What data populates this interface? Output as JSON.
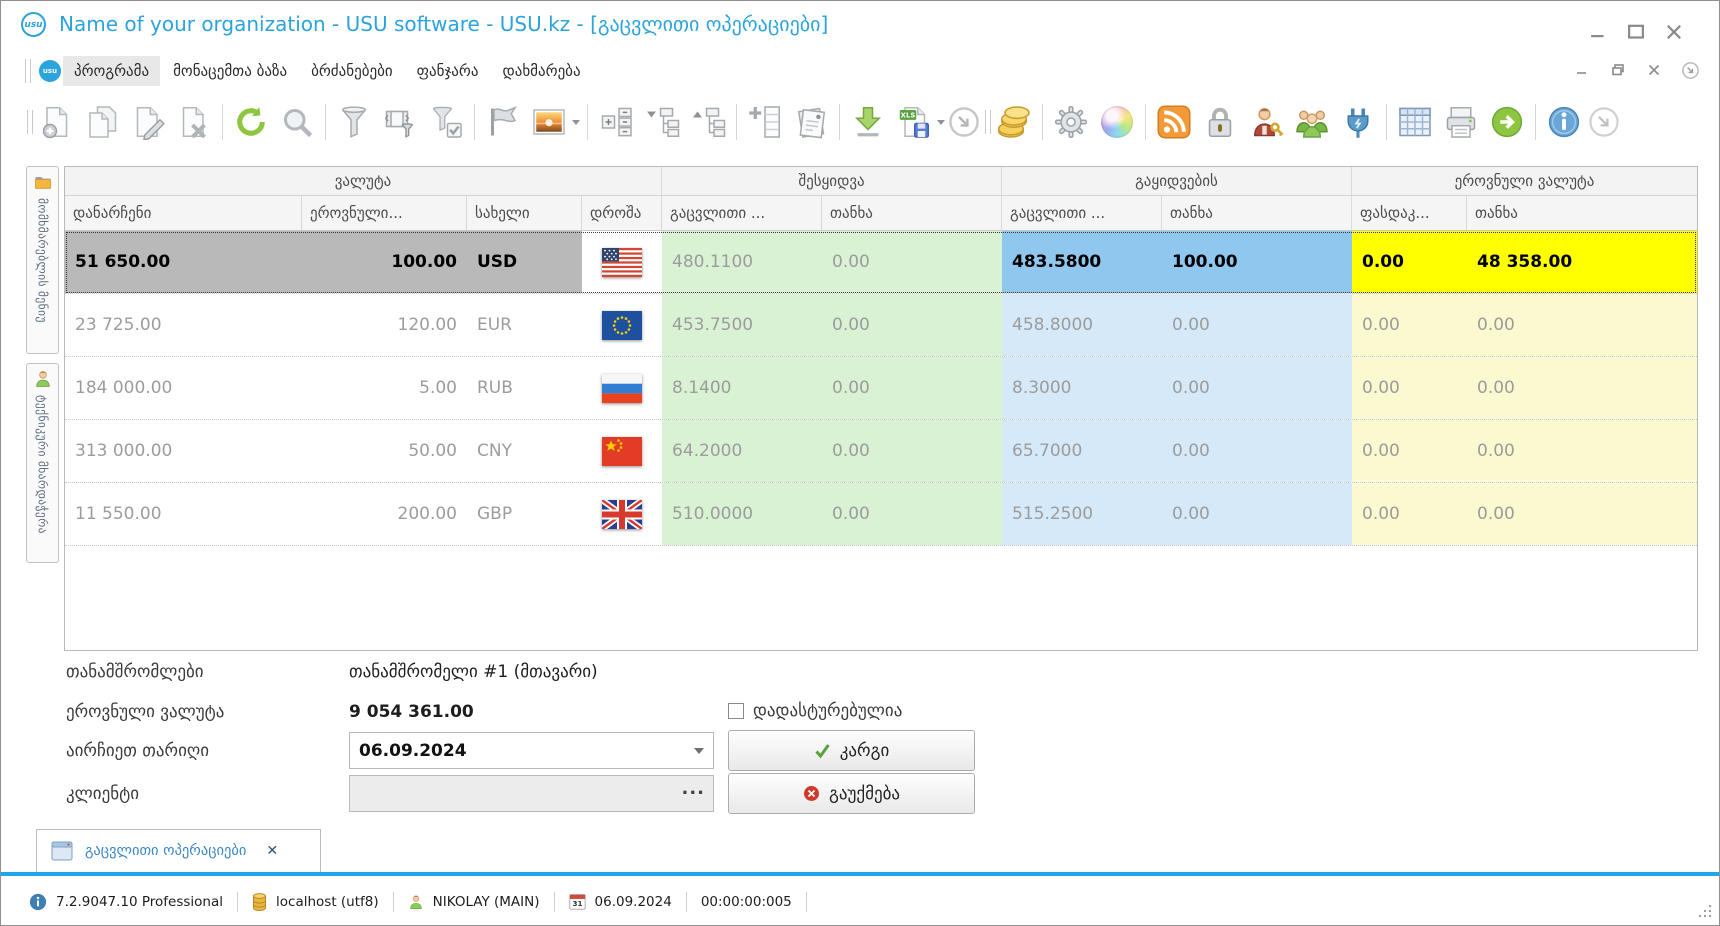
{
  "window": {
    "title": "Name of your organization - USU software - USU.kz - [გაცვლითი ოპერაციები]",
    "logo_text": "usu"
  },
  "menu": {
    "items": [
      "პროგრამა",
      "მონაცემთა ბაზა",
      "ბრძანებები",
      "ფანჯარა",
      "დახმარება"
    ],
    "active_item": "პროგრამა"
  },
  "toolbar": {
    "icons": [
      "new-record",
      "copy-record",
      "edit-record",
      "delete-record",
      "refresh",
      "search",
      "filter",
      "filter-window",
      "filter-custom",
      "flag",
      "image",
      "row-height",
      "collapse-tree",
      "expand-tree",
      "add-column",
      "report",
      "import",
      "export-xls",
      "more",
      "money",
      "settings",
      "theme",
      "rss-feed",
      "lock",
      "user-permissions",
      "users",
      "plugin",
      "grid",
      "print",
      "next",
      "info",
      "overflow"
    ]
  },
  "sidebar": {
    "tabs": [
      {
        "label": "მომხმარებლის მენიუ",
        "icon": "folder-icon"
      },
      {
        "label": "ტექნიკური მხარდაჭერა",
        "icon": "person-icon"
      }
    ]
  },
  "table": {
    "groups": [
      "ვალუტა",
      "შესყიდვა",
      "გაყიდვების",
      "ეროვნული ვალუტა"
    ],
    "columns": [
      "დანარჩენი",
      "ეროვნული...",
      "სახელი",
      "დროშა",
      "გაცვლითი ...",
      "თანხა",
      "გაცვლითი ...",
      "თანხა",
      "ფასდაკ...",
      "თანხა"
    ],
    "rows": [
      {
        "remaining": "51 650.00",
        "national": "100.00",
        "name": "USD",
        "flag": "us",
        "buy_rate": "480.1100",
        "buy_amount": "0.00",
        "sell_rate": "483.5800",
        "sell_amount": "100.00",
        "discount": "0.00",
        "amount": "48 358.00",
        "selected": true
      },
      {
        "remaining": "23 725.00",
        "national": "120.00",
        "name": "EUR",
        "flag": "eu",
        "buy_rate": "453.7500",
        "buy_amount": "0.00",
        "sell_rate": "458.8000",
        "sell_amount": "0.00",
        "discount": "0.00",
        "amount": "0.00",
        "selected": false
      },
      {
        "remaining": "184 000.00",
        "national": "5.00",
        "name": "RUB",
        "flag": "ru",
        "buy_rate": "8.1400",
        "buy_amount": "0.00",
        "sell_rate": "8.3000",
        "sell_amount": "0.00",
        "discount": "0.00",
        "amount": "0.00",
        "selected": false
      },
      {
        "remaining": "313 000.00",
        "national": "50.00",
        "name": "CNY",
        "flag": "cn",
        "buy_rate": "64.2000",
        "buy_amount": "0.00",
        "sell_rate": "65.7000",
        "sell_amount": "0.00",
        "discount": "0.00",
        "amount": "0.00",
        "selected": false
      },
      {
        "remaining": "11 550.00",
        "national": "200.00",
        "name": "GBP",
        "flag": "gb",
        "buy_rate": "510.0000",
        "buy_amount": "0.00",
        "sell_rate": "515.2500",
        "sell_amount": "0.00",
        "discount": "0.00",
        "amount": "0.00",
        "selected": false
      }
    ],
    "colors": {
      "buy_bg": "#d9f2d3",
      "sell_bg": "#d5e9f8",
      "national_bg": "#fbf9d0",
      "selected_row_bg": "#b9b9b9",
      "selected_sell_bg": "#8fc7ef",
      "selected_national_bg": "#ffff00"
    }
  },
  "form": {
    "employees_label": "თანამშრომლები",
    "employees_value": "თანამშრომელი #1 (მთავარი)",
    "national_label": "ეროვნული ვალუტა",
    "national_value": "9 054 361.00",
    "confirmed_label": "დადასტურებულია",
    "confirmed_checked": false,
    "date_label": "აირჩიეთ თარიღი",
    "date_value": "06.09.2024",
    "client_label": "კლიენტი",
    "client_value": "",
    "ellipsis": "...",
    "ok_label": "კარგი",
    "cancel_label": "გაუქმება"
  },
  "tabstrip": {
    "tab_label": "გაცვლითი ოპერაციები",
    "close": "✕"
  },
  "statusbar": {
    "version": "7.2.9047.10 Professional",
    "database": "localhost (utf8)",
    "user": "NIKOLAY (MAIN)",
    "date": "06.09.2024",
    "time": "00:00:00:005"
  },
  "colors": {
    "title_blue": "#2ba3dc",
    "tab_underline": "#1ea7e8"
  }
}
